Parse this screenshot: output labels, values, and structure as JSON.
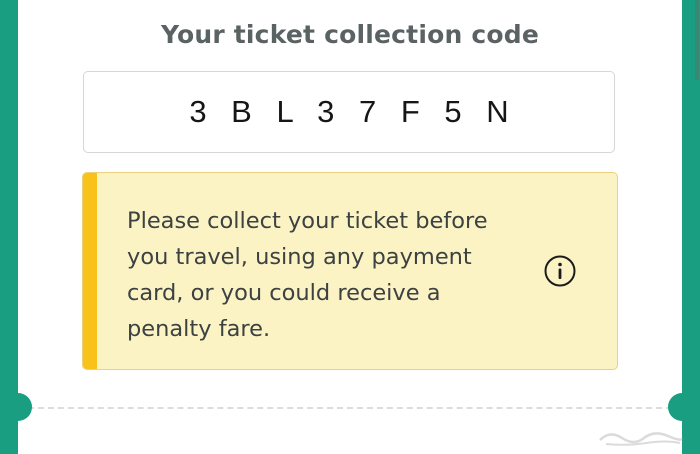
{
  "ticket": {
    "title": "Your ticket collection code",
    "code": "3 B L 3 7 F 5 N"
  },
  "notice": {
    "message": "Please collect your ticket before you travel, using any payment card, or you could receive a penalty fare.",
    "icon": "info-icon",
    "accent_color": "#f8c21a",
    "background_color": "#fcf3c5"
  },
  "theme": {
    "brand_color": "#1a9e82"
  }
}
